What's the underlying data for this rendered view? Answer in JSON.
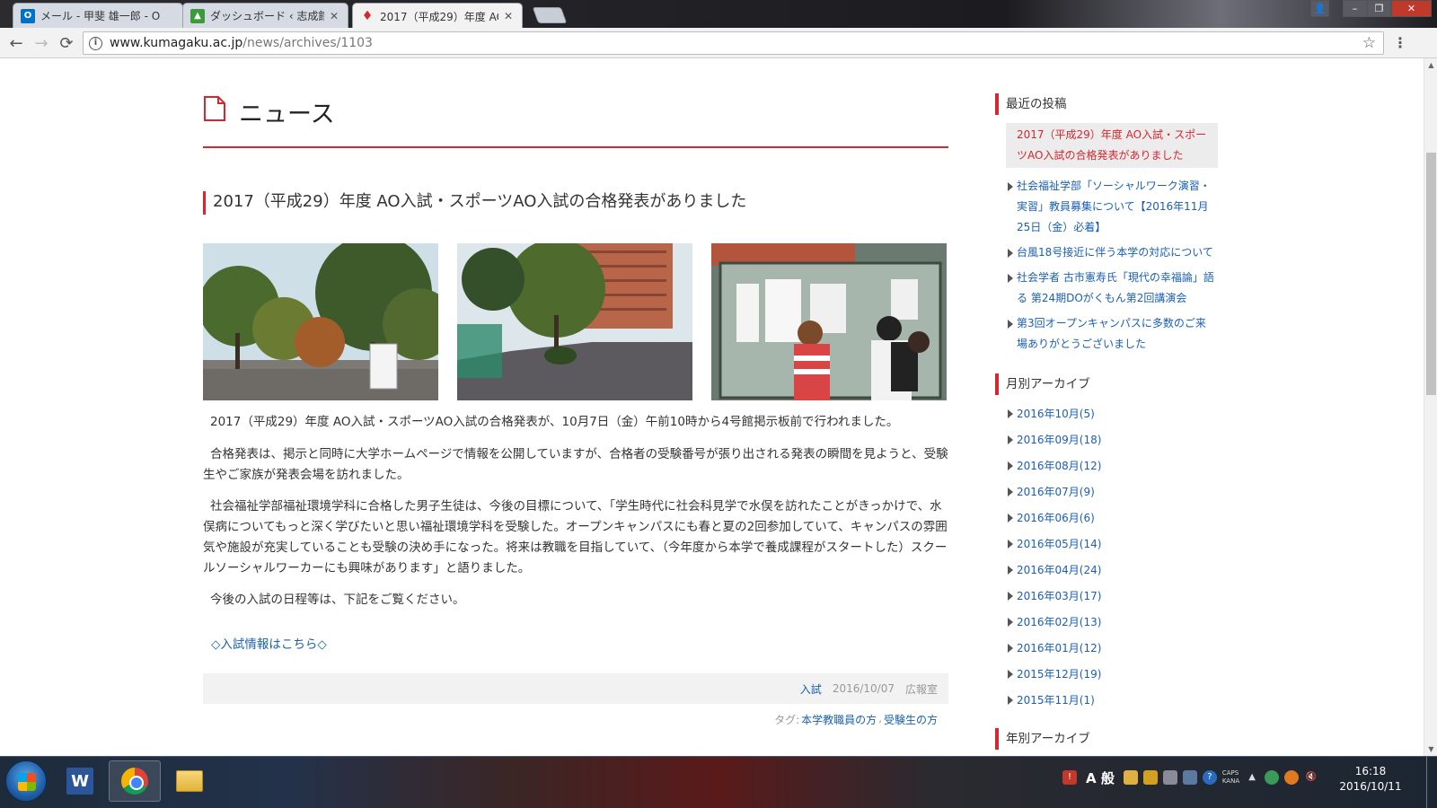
{
  "browser": {
    "tabs": [
      {
        "title": "メール - 甲斐 雄一郎 - O",
        "icon": "outlook-icon",
        "color": "#0072c6"
      },
      {
        "title": "ダッシュボード ‹ 志成館",
        "icon": "wordpress-dashboard-icon",
        "color": "#3c9a3c"
      },
      {
        "title": "2017（平成29）年度 AO",
        "icon": "kumagaku-icon",
        "color": "#d7262f"
      }
    ],
    "url_host": "www.kumagaku.ac.jp",
    "url_path": "/news/archives/1103"
  },
  "page": {
    "section_title": "ニュース",
    "post_title": "2017（平成29）年度 AO入試・スポーツAO入試の合格発表がありました",
    "paragraphs": [
      "2017（平成29）年度 AO入試・スポーツAO入試の合格発表が、10月7日（金）午前10時から4号館掲示板前で行われました。",
      "合格発表は、掲示と同時に大学ホームページで情報を公開していますが、合格者の受験番号が張り出される発表の瞬間を見ようと、受験生やご家族が発表会場を訪れました。",
      "社会福祉学部福祉環境学科に合格した男子生徒は、今後の目標について、「学生時代に社会科見学で水俣を訪れたことがきっかけで、水俣病についてもっと深く学びたいと思い福祉環境学科を受験した。オープンキャンパスにも春と夏の2回参加していて、キャンパスの雰囲気や施設が充実していることも受験の決め手になった。将来は教職を目指していて、（今年度から本学で養成課程がスタートした）スクールソーシャルワーカーにも興味があります」と語りました。",
      "今後の入試の日程等は、下記をご覧ください。"
    ],
    "link_text": "◇入試情報はこちら◇",
    "meta": {
      "category": "入試",
      "date": "2016/10/07",
      "author": "広報室"
    },
    "tags_label": "タグ:",
    "tags": [
      "本学教職員の方",
      "受験生の方"
    ],
    "tag_separator": ","
  },
  "sidebar": {
    "recent_title": "最近の投稿",
    "recent": [
      "2017（平成29）年度 AO入試・スポーツAO入試の合格発表がありました",
      "社会福祉学部「ソーシャルワーク演習・実習」教員募集について【2016年11月25日（金）必着】",
      "台風18号接近に伴う本学の対応について",
      "社会学者 古市憲寿氏「現代の幸福論」語る 第24期DOがくもん第2回講演会",
      "第3回オープンキャンパスに多数のご来場ありがとうございました"
    ],
    "monthly_title": "月別アーカイブ",
    "monthly": [
      "2016年10月(5)",
      "2016年09月(18)",
      "2016年08月(12)",
      "2016年07月(9)",
      "2016年06月(6)",
      "2016年05月(14)",
      "2016年04月(24)",
      "2016年03月(17)",
      "2016年02月(13)",
      "2016年01月(12)",
      "2015年12月(19)",
      "2015年11月(1)"
    ],
    "yearly_title": "年別アーカイブ"
  },
  "taskbar": {
    "ime_label": "A 般",
    "caps_label": "CAPS",
    "kana_label": "KANA",
    "time": "16:18",
    "date": "2016/10/11"
  },
  "colors": {
    "accent": "#d7262f",
    "link": "#1a5fb4"
  }
}
